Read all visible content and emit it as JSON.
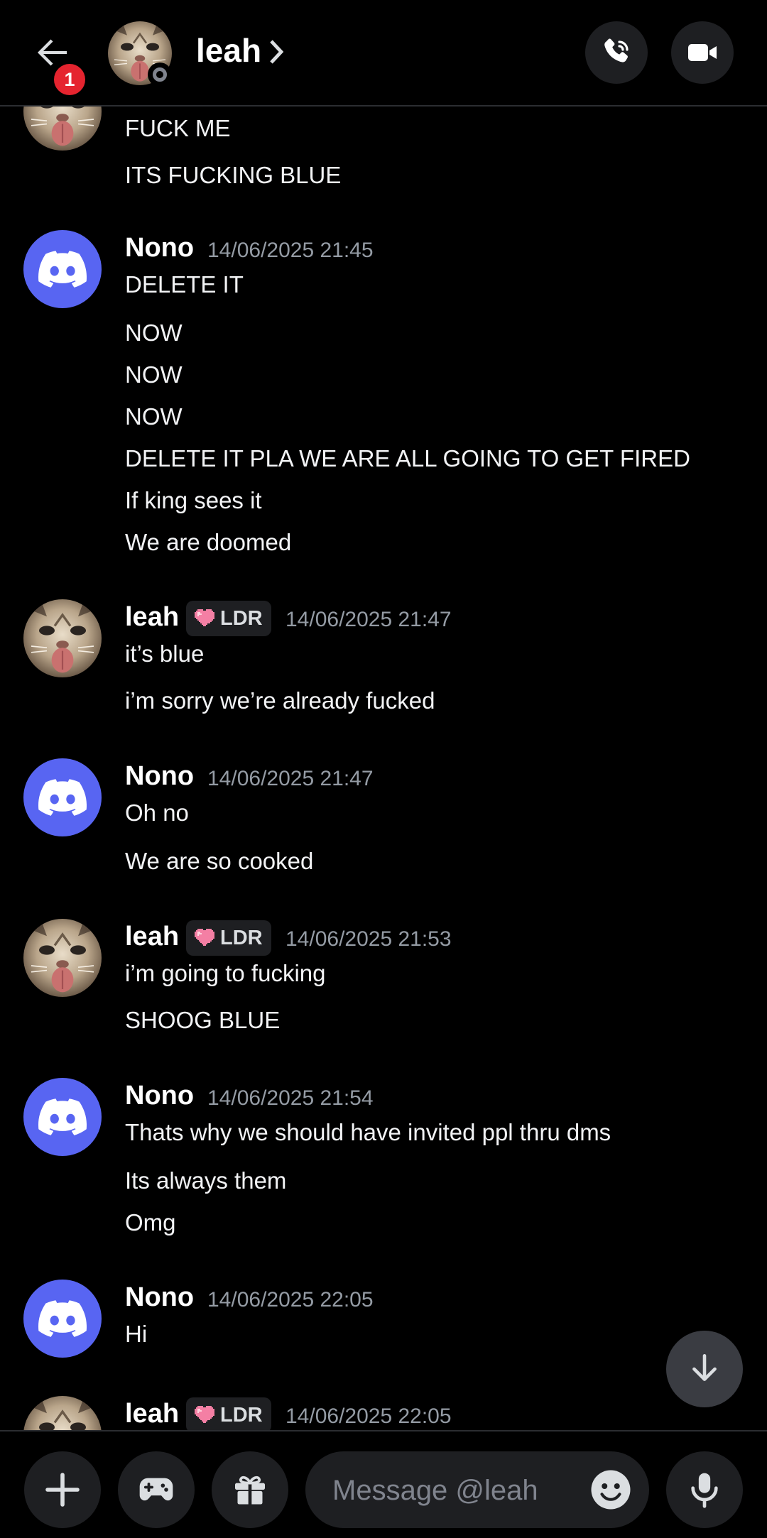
{
  "header": {
    "notification_count": "1",
    "name": "leah"
  },
  "colors": {
    "background": "#000000",
    "blurple": "#5865f2",
    "badge_red": "#e5242f",
    "timestamp": "#949ba4",
    "surface": "#1e1f22"
  },
  "icons": {
    "back": "back-arrow-icon",
    "call": "phone-icon",
    "video": "video-camera-icon",
    "add": "plus-icon",
    "apps": "gamepad-icon",
    "gift": "gift-icon",
    "emoji": "emoji-icon",
    "voice": "microphone-icon",
    "jump": "arrow-down-icon"
  },
  "messages": [
    {
      "lines": [
        "FUCK ME",
        "ITS FUCKING BLUE"
      ]
    },
    {
      "author": "Nono",
      "timestamp": "14/06/2025 21:45",
      "lines": [
        "DELETE IT",
        "NOW",
        "NOW",
        "NOW",
        "DELETE IT PLA WE ARE ALL GOING TO GET FIRED",
        "If king sees it",
        "We are doomed"
      ]
    },
    {
      "author": "leah",
      "tag": "LDR",
      "timestamp": "14/06/2025 21:47",
      "lines": [
        "it’s blue",
        "i’m sorry we’re already fucked"
      ]
    },
    {
      "author": "Nono",
      "timestamp": "14/06/2025 21:47",
      "lines": [
        "Oh no",
        "We are so cooked"
      ]
    },
    {
      "author": "leah",
      "tag": "LDR",
      "timestamp": "14/06/2025 21:53",
      "lines": [
        "i’m going to fucking",
        "SHOOG BLUE"
      ]
    },
    {
      "author": "Nono",
      "timestamp": "14/06/2025 21:54",
      "lines": [
        "Thats why we should have invited ppl thru dms",
        "Its always them",
        "Omg"
      ]
    },
    {
      "author": "Nono",
      "timestamp": "14/06/2025 22:05",
      "lines": [
        "Hi"
      ]
    },
    {
      "author": "leah",
      "tag": "LDR",
      "timestamp": "14/06/2025 22:05",
      "lines": []
    }
  ],
  "composer": {
    "placeholder": "Message @leah"
  }
}
